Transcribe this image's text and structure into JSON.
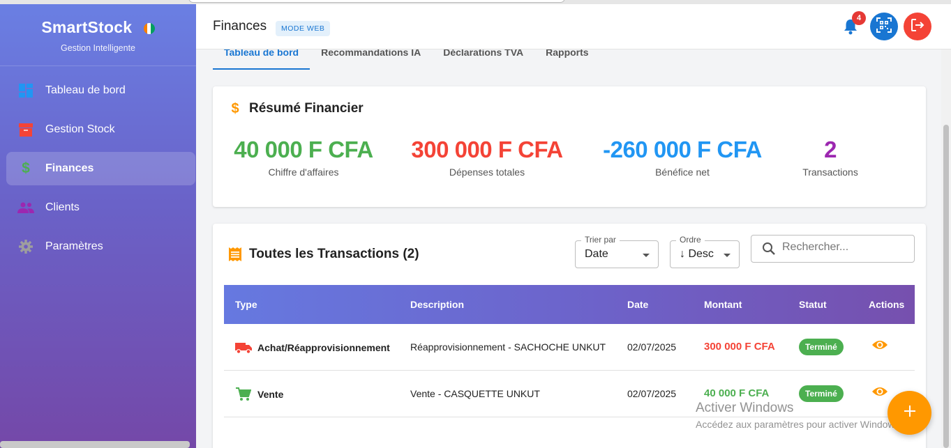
{
  "brand": {
    "name": "SmartStock",
    "subtitle": "Gestion Intelligente",
    "flag_colors": [
      "#f77f00",
      "#ffffff",
      "#009e60"
    ]
  },
  "sidebar": {
    "items": [
      {
        "label": "Tableau de bord",
        "icon": "dashboard-icon",
        "color": "#2196f3",
        "active": false
      },
      {
        "label": "Gestion Stock",
        "icon": "inventory-icon",
        "color": "#f44336",
        "active": false
      },
      {
        "label": "Finances",
        "icon": "dollar-icon",
        "color": "#4caf50",
        "active": true
      },
      {
        "label": "Clients",
        "icon": "people-icon",
        "color": "#9c27b0",
        "active": false
      },
      {
        "label": "Paramètres",
        "icon": "gear-icon",
        "color": "#9e9e9e",
        "active": false
      }
    ]
  },
  "header": {
    "title": "Finances",
    "mode_badge": "MODE WEB",
    "notification_count": "4"
  },
  "tabs": [
    {
      "label": "Tableau de bord",
      "active": true
    },
    {
      "label": "Recommandations IA",
      "active": false
    },
    {
      "label": "Déclarations TVA",
      "active": false
    },
    {
      "label": "Rapports",
      "active": false
    }
  ],
  "summary": {
    "title": "Résumé Financier",
    "stats": [
      {
        "value": "40 000 F CFA",
        "label": "Chiffre d'affaires",
        "color": "#4caf50"
      },
      {
        "value": "300 000 F CFA",
        "label": "Dépenses totales",
        "color": "#f44336"
      },
      {
        "value": "-260 000 F CFA",
        "label": "Bénéfice net",
        "color": "#2196f3"
      },
      {
        "value": "2",
        "label": "Transactions",
        "color": "#9c27b0"
      }
    ]
  },
  "transactions": {
    "title": "Toutes les Transactions (2)",
    "sort": {
      "label": "Trier par",
      "value": "Date"
    },
    "order": {
      "label": "Ordre",
      "value": "↓ Desc"
    },
    "search": {
      "placeholder": "Rechercher..."
    },
    "columns": [
      "Type",
      "Description",
      "Date",
      "Montant",
      "Statut",
      "Actions"
    ],
    "rows": [
      {
        "type": "Achat/Réapprovisionnement",
        "icon": "truck-icon",
        "icon_color": "#f44336",
        "description": "Réapprovisionnement - SACHOCHE UNKUT",
        "date": "02/07/2025",
        "amount": "300 000 F CFA",
        "amount_color": "#f44336",
        "status": "Terminé"
      },
      {
        "type": "Vente",
        "icon": "cart-icon",
        "icon_color": "#4caf50",
        "description": "Vente - CASQUETTE UNKUT",
        "date": "02/07/2025",
        "amount": "40 000 F CFA",
        "amount_color": "#4caf50",
        "status": "Terminé"
      }
    ]
  },
  "watermark": {
    "title": "Activer Windows",
    "subtitle": "Accédez aux paramètres pour activer Windows."
  },
  "colors": {
    "primary": "#1976d2",
    "accent": "#ff9800",
    "success": "#4caf50",
    "danger": "#f44336"
  }
}
